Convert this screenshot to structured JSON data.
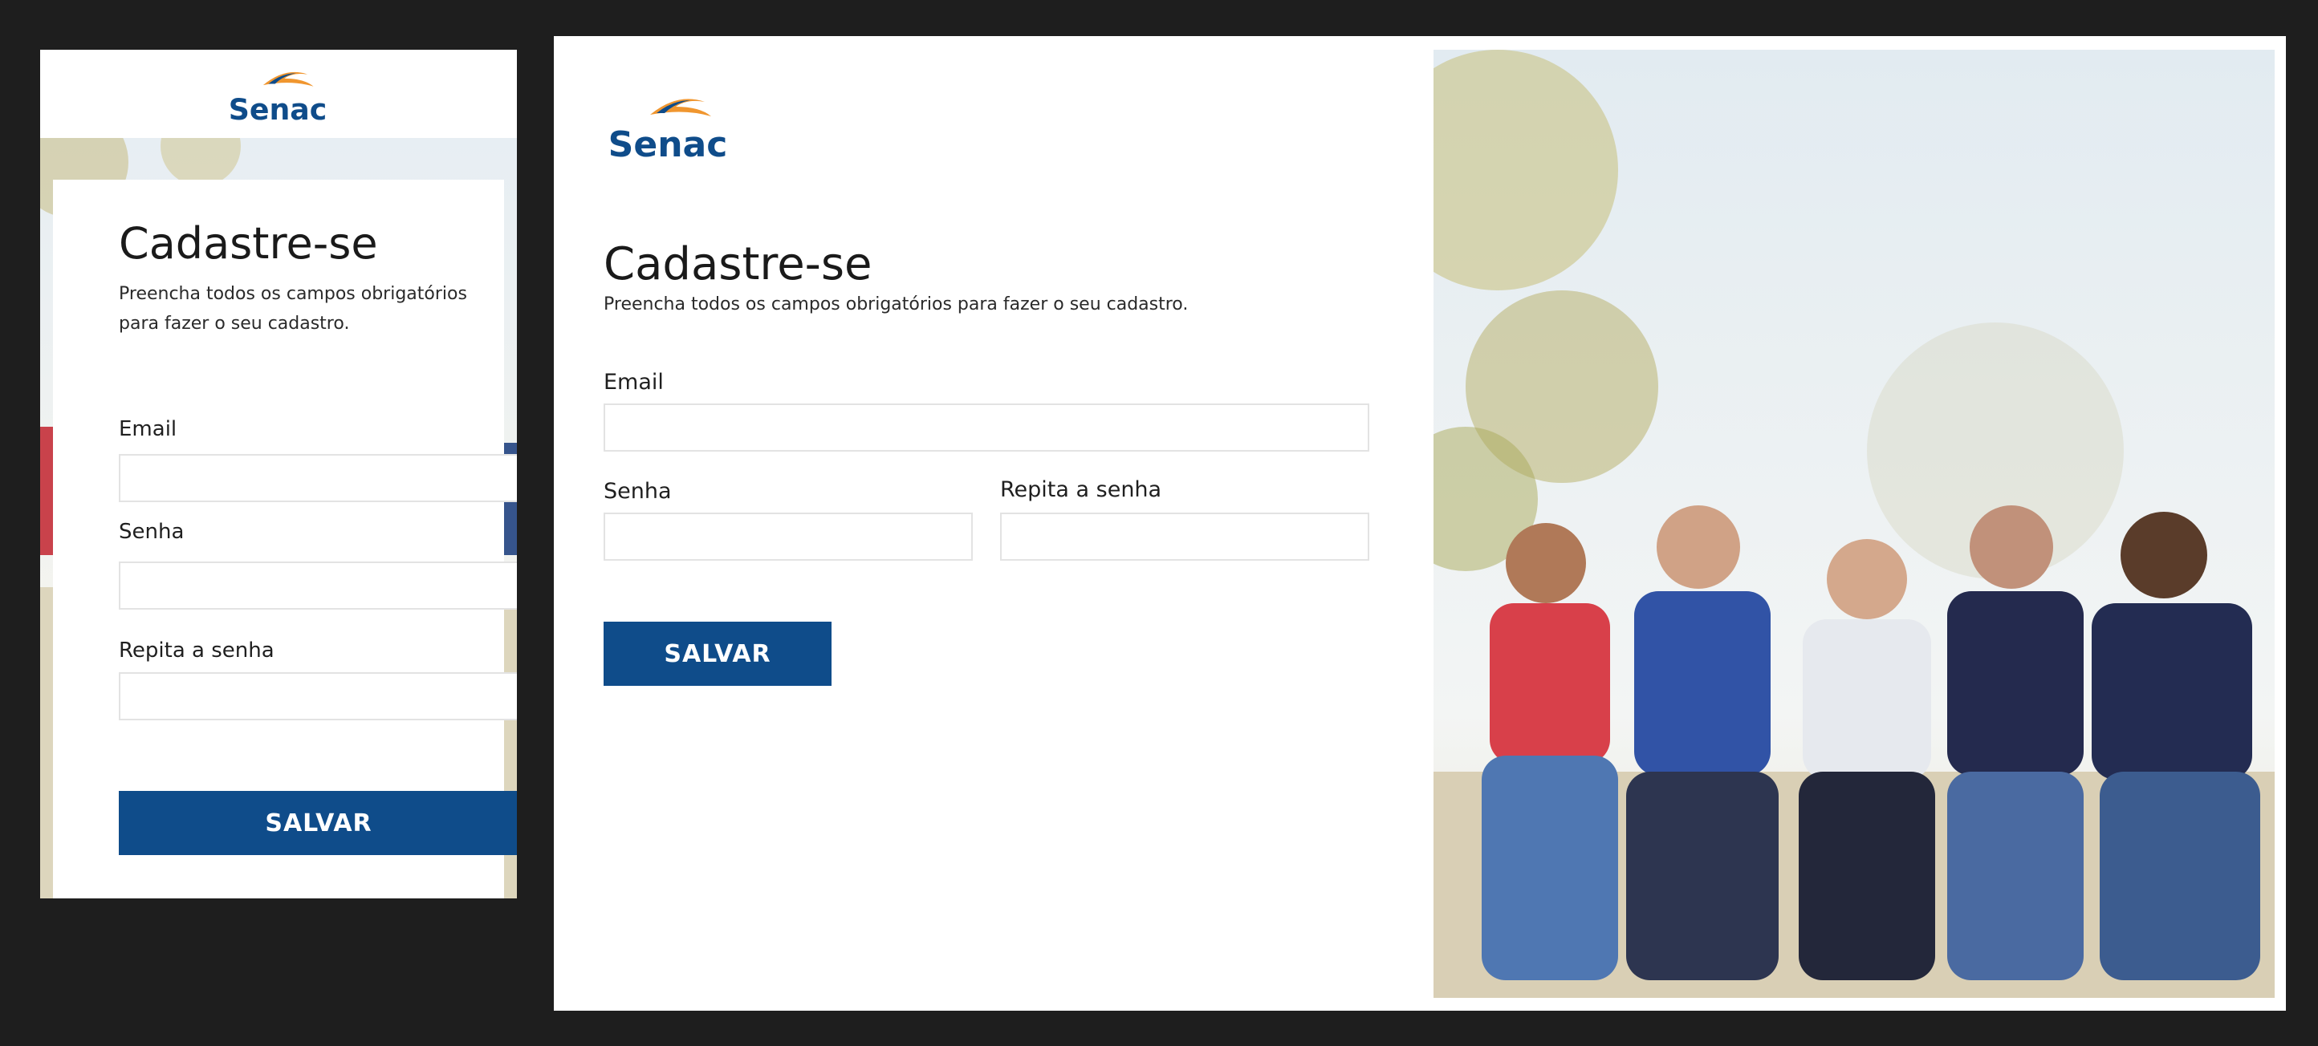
{
  "brand": {
    "name": "Senac",
    "primary_color": "#0f4c8a",
    "accent_color": "#f0962f"
  },
  "form": {
    "title": "Cadastre-se",
    "subtitle": "Preencha todos os campos obrigatórios para fazer o seu cadastro.",
    "email_label": "Email",
    "email_value": "",
    "password_label": "Senha",
    "password_value": "",
    "repeat_password_label": "Repita a senha",
    "repeat_password_value": "",
    "save_label": "SALVAR"
  },
  "colors": {
    "background": "#1e1e1e",
    "field_border": "#e3e3e3",
    "mobile_footer": "#ddd6bd"
  }
}
